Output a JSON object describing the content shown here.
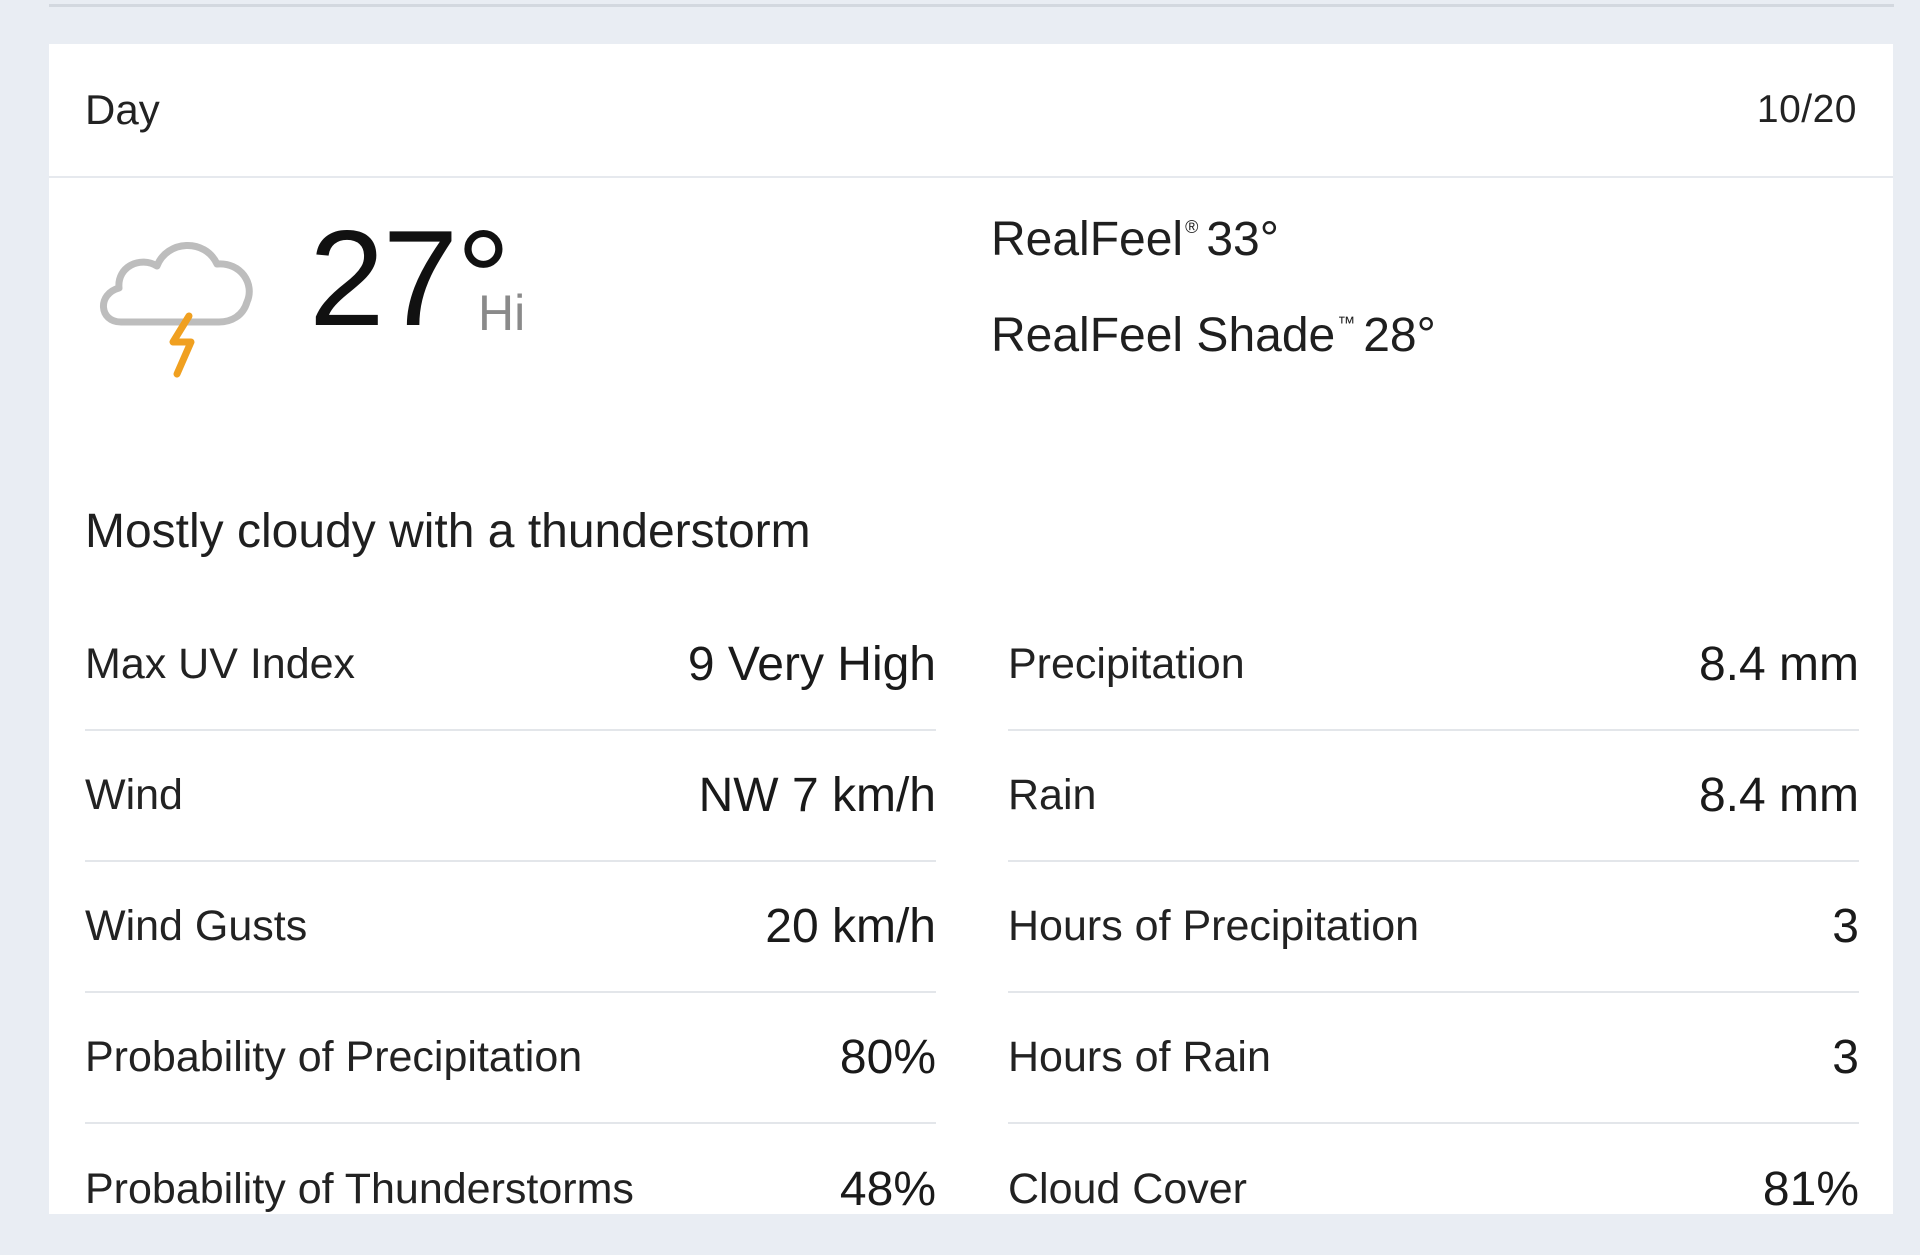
{
  "header": {
    "title": "Day",
    "date": "10/20"
  },
  "current": {
    "icon": "thunderstorm-cloud-icon",
    "temperature": "27°",
    "temperature_label": "Hi",
    "realfeel_label": "RealFeel",
    "realfeel_mark": "®",
    "realfeel_value": "33°",
    "realfeel_shade_label": "RealFeel Shade",
    "realfeel_shade_mark": "™",
    "realfeel_shade_value": "28°",
    "phrase": "Mostly cloudy with a thunderstorm"
  },
  "details": {
    "left": [
      {
        "label": "Max UV Index",
        "value": "9 Very High"
      },
      {
        "label": "Wind",
        "value": "NW 7 km/h"
      },
      {
        "label": "Wind Gusts",
        "value": "20 km/h"
      },
      {
        "label": "Probability of Precipitation",
        "value": "80%"
      },
      {
        "label": "Probability of Thunderstorms",
        "value": "48%"
      }
    ],
    "right": [
      {
        "label": "Precipitation",
        "value": "8.4 mm"
      },
      {
        "label": "Rain",
        "value": "8.4 mm"
      },
      {
        "label": "Hours of Precipitation",
        "value": "3"
      },
      {
        "label": "Hours of Rain",
        "value": "3"
      },
      {
        "label": "Cloud Cover",
        "value": "81%"
      }
    ]
  },
  "colors": {
    "background": "#e9edf3",
    "card": "#ffffff",
    "bolt": "#f0a020",
    "cloud_stroke": "#bdbdbd"
  }
}
